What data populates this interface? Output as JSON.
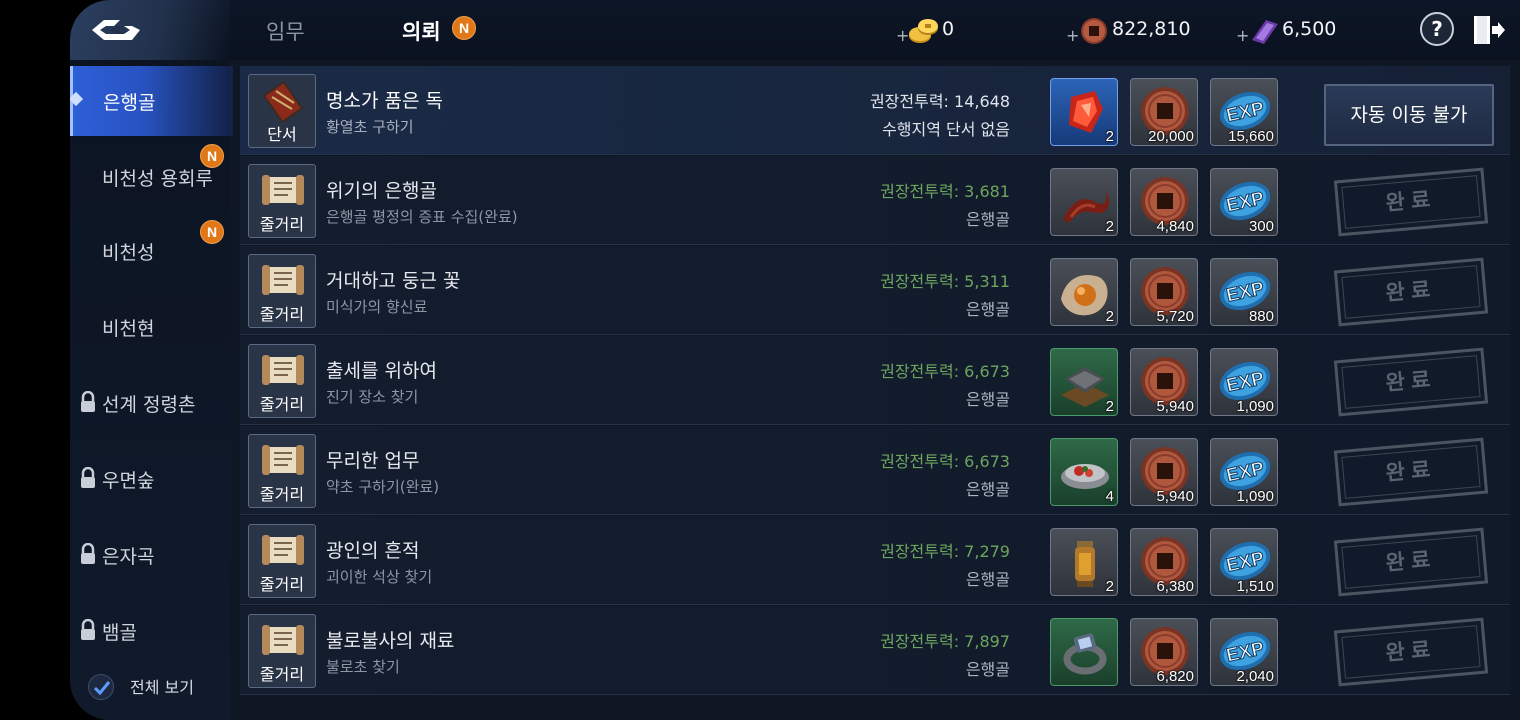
{
  "header": {
    "tabs": [
      {
        "label": "임무",
        "active": false
      },
      {
        "label": "의뢰",
        "active": true,
        "badge": "N"
      }
    ],
    "currencies": [
      {
        "icon": "gold-coins-icon",
        "plus": "+",
        "value": "0"
      },
      {
        "icon": "copper-coin-icon",
        "plus": "+",
        "value": "822,810"
      },
      {
        "icon": "purple-jade-icon",
        "plus": "+",
        "value": "6,500"
      }
    ],
    "help_label": "?"
  },
  "sidebar": {
    "items": [
      {
        "label": "은행골",
        "selected": true,
        "locked": false
      },
      {
        "label": "비천성 용회루",
        "badge": "N",
        "locked": false
      },
      {
        "label": "비천성",
        "badge": "N",
        "locked": false
      },
      {
        "label": "비천현",
        "locked": false
      },
      {
        "label": "선계 정령촌",
        "locked": true
      },
      {
        "label": "우면숲",
        "locked": true
      },
      {
        "label": "은자곡",
        "locked": true
      },
      {
        "label": "뱀골",
        "locked": true
      }
    ],
    "view_all": {
      "label": "전체 보기",
      "checked": true
    }
  },
  "quests": [
    {
      "type": "단서",
      "title": "명소가 품은 독",
      "subtitle": "황열초 구하기",
      "power": "권장전투력: 14,648",
      "location": "수행지역 단서 없음",
      "rewards": {
        "item_qty": "2",
        "coin": "20,000",
        "exp": "15,660"
      },
      "item_icon": "red-crystal-icon",
      "item_bg": "blue",
      "action": "자동 이동 불가",
      "completed": false
    },
    {
      "type": "줄거리",
      "title": "위기의 은행골",
      "subtitle": "은행골 평정의 증표 수집(완료)",
      "power": "권장전투력: 3,681",
      "location": "은행골",
      "rewards": {
        "item_qty": "2",
        "coin": "4,840",
        "exp": "300"
      },
      "item_icon": "tentacle-icon",
      "item_bg": "gray",
      "action": "완료",
      "completed": true
    },
    {
      "type": "줄거리",
      "title": "거대하고 둥근 꽃",
      "subtitle": "미식가의 향신료",
      "power": "권장전투력: 5,311",
      "location": "은행골",
      "rewards": {
        "item_qty": "2",
        "coin": "5,720",
        "exp": "880"
      },
      "item_icon": "orange-orb-icon",
      "item_bg": "gray",
      "action": "완료",
      "completed": true
    },
    {
      "type": "줄거리",
      "title": "출세를 위하여",
      "subtitle": "진기 장소 찾기",
      "power": "권장전투력: 6,673",
      "location": "은행골",
      "rewards": {
        "item_qty": "2",
        "coin": "5,940",
        "exp": "1,090"
      },
      "item_icon": "stone-tablet-icon",
      "item_bg": "green",
      "action": "완료",
      "completed": true
    },
    {
      "type": "줄거리",
      "title": "무리한 업무",
      "subtitle": "약초 구하기(완료)",
      "power": "권장전투력: 6,673",
      "location": "은행골",
      "rewards": {
        "item_qty": "4",
        "coin": "5,940",
        "exp": "1,090"
      },
      "item_icon": "herb-bowl-icon",
      "item_bg": "green",
      "action": "완료",
      "completed": true
    },
    {
      "type": "줄거리",
      "title": "광인의 흔적",
      "subtitle": "괴이한 석상 찾기",
      "power": "권장전투력: 7,279",
      "location": "은행골",
      "rewards": {
        "item_qty": "2",
        "coin": "6,380",
        "exp": "1,510"
      },
      "item_icon": "lantern-icon",
      "item_bg": "gray",
      "action": "완료",
      "completed": true
    },
    {
      "type": "줄거리",
      "title": "불로불사의 재료",
      "subtitle": "불로초 찾기",
      "power": "권장전투력: 7,897",
      "location": "은행골",
      "rewards": {
        "item_qty": "",
        "coin": "6,820",
        "exp": "2,040"
      },
      "item_icon": "ring-icon",
      "item_bg": "green",
      "action": "완료",
      "completed": true
    }
  ],
  "colors": {
    "accent_blue": "#2e5fd8",
    "badge_orange": "#e07818",
    "power_green": "#6da55f",
    "background": "#0f1725"
  }
}
